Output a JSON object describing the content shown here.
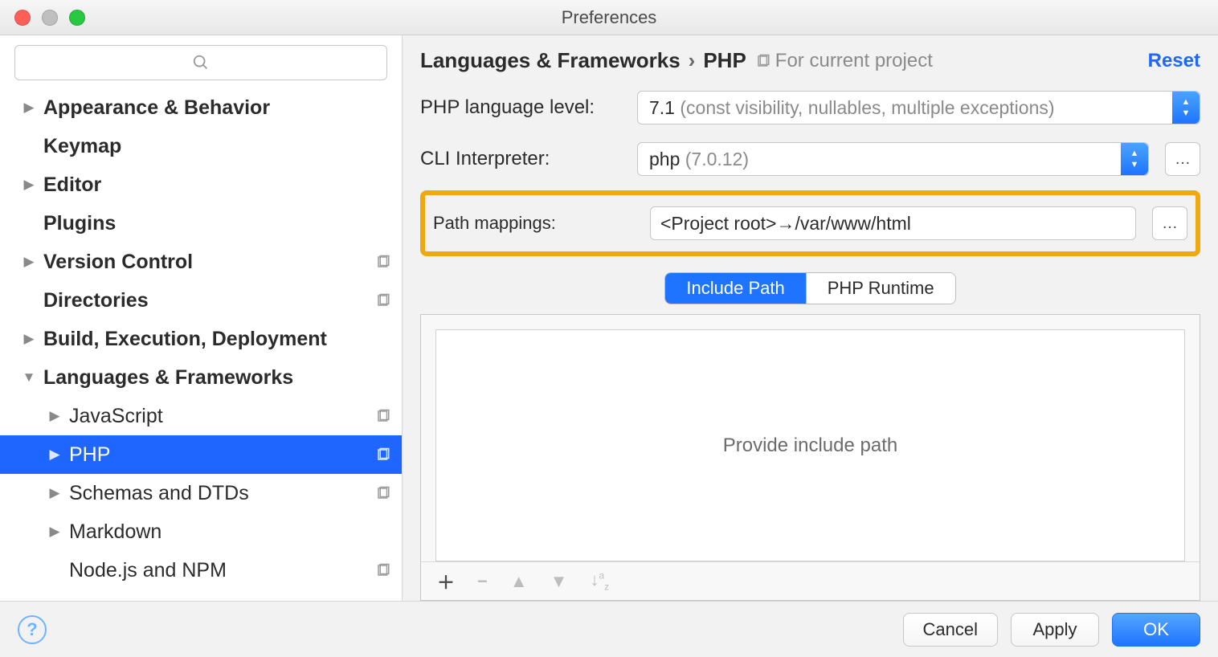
{
  "window": {
    "title": "Preferences"
  },
  "sidebar": {
    "search_placeholder": "",
    "items": [
      {
        "label": "Appearance & Behavior",
        "bold": true,
        "disc": "closed",
        "proj": false,
        "indent": 0
      },
      {
        "label": "Keymap",
        "bold": true,
        "disc": "none",
        "proj": false,
        "indent": 0
      },
      {
        "label": "Editor",
        "bold": true,
        "disc": "closed",
        "proj": false,
        "indent": 0
      },
      {
        "label": "Plugins",
        "bold": true,
        "disc": "none",
        "proj": false,
        "indent": 0
      },
      {
        "label": "Version Control",
        "bold": true,
        "disc": "closed",
        "proj": true,
        "indent": 0
      },
      {
        "label": "Directories",
        "bold": true,
        "disc": "none",
        "proj": true,
        "indent": 0
      },
      {
        "label": "Build, Execution, Deployment",
        "bold": true,
        "disc": "closed",
        "proj": false,
        "indent": 0
      },
      {
        "label": "Languages & Frameworks",
        "bold": true,
        "disc": "open",
        "proj": false,
        "indent": 0
      },
      {
        "label": "JavaScript",
        "bold": false,
        "disc": "closed",
        "proj": true,
        "indent": 1
      },
      {
        "label": "PHP",
        "bold": false,
        "disc": "closed",
        "proj": true,
        "indent": 1,
        "selected": true
      },
      {
        "label": "Schemas and DTDs",
        "bold": false,
        "disc": "closed",
        "proj": true,
        "indent": 1
      },
      {
        "label": "Markdown",
        "bold": false,
        "disc": "closed",
        "proj": false,
        "indent": 1
      },
      {
        "label": "Node.js and NPM",
        "bold": false,
        "disc": "none",
        "proj": true,
        "indent": 1
      }
    ]
  },
  "breadcrumb": {
    "a": "Languages & Frameworks",
    "b": "PHP",
    "scope": "For current project",
    "reset": "Reset"
  },
  "form": {
    "lang_label": "PHP language level:",
    "lang_value": "7.1",
    "lang_hint": "(const visibility, nullables, multiple exceptions)",
    "cli_label": "CLI Interpreter:",
    "cli_value": "php",
    "cli_hint": "(7.0.12)",
    "path_label": "Path mappings:",
    "path_value": "<Project root>→/var/www/html"
  },
  "tabs": {
    "a": "Include Path",
    "b": "PHP Runtime"
  },
  "panel": {
    "placeholder": "Provide include path"
  },
  "footer": {
    "cancel": "Cancel",
    "apply": "Apply",
    "ok": "OK"
  }
}
